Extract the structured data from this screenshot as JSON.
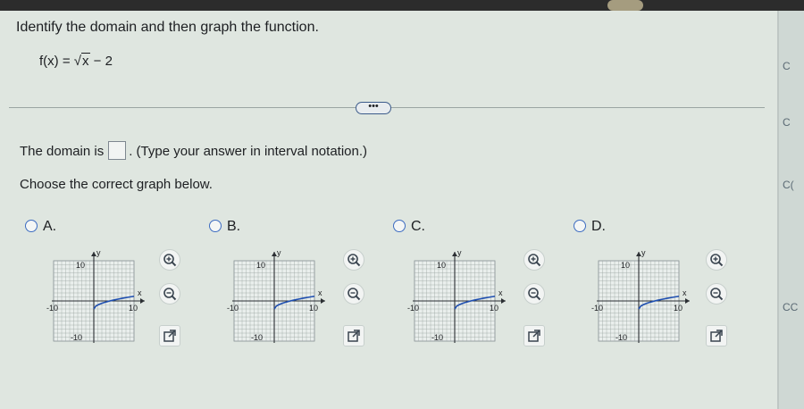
{
  "question": {
    "prompt": "Identify the domain and then graph the function.",
    "function_lhs": "f(x) = ",
    "function_radicand": "x",
    "function_rest": " − 2",
    "more_button": "•••"
  },
  "domain_part": {
    "before": "The domain is",
    "after": ". (Type your answer in interval notation.)"
  },
  "choose_text": "Choose the correct graph below.",
  "options": [
    {
      "letter": "A.",
      "x_tick": "10",
      "y_tick_top": "10",
      "y_tick_bottom": "-10",
      "x_tick_left": "-10"
    },
    {
      "letter": "B.",
      "x_tick": "10",
      "y_tick_top": "10",
      "y_tick_bottom": "-10",
      "x_tick_left": "-10"
    },
    {
      "letter": "C.",
      "x_tick": "10",
      "y_tick_top": "10",
      "y_tick_bottom": "-10",
      "x_tick_left": "-10"
    },
    {
      "letter": "D.",
      "x_tick": "10",
      "y_tick_top": "10",
      "y_tick_bottom": "-10",
      "x_tick_left": "-10"
    }
  ],
  "axis_labels": {
    "x": "x",
    "y": "y"
  },
  "right_strip": [
    "C",
    "C",
    "C(",
    "CC"
  ],
  "colors": {
    "accent": "#3d6cc1",
    "curve": "#1f4fb0",
    "grid": "#9aa4a2"
  },
  "icons": [
    "zoom-in-icon",
    "zoom-out-icon",
    "external-link-icon"
  ]
}
